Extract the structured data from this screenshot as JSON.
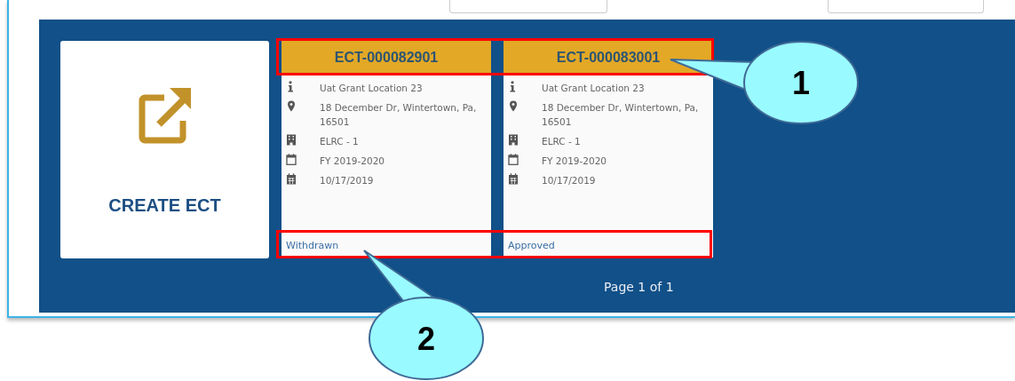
{
  "create_tile": {
    "label": "CREATE ECT"
  },
  "cards": [
    {
      "id": "ECT-000082901",
      "details": [
        {
          "kind": "info",
          "text": "Uat Grant Location 23"
        },
        {
          "kind": "location",
          "text": "18 December Dr, Wintertown, Pa, 16501"
        },
        {
          "kind": "building",
          "text": "ELRC - 1"
        },
        {
          "kind": "calendar",
          "text": "FY 2019-2020"
        },
        {
          "kind": "date",
          "text": "10/17/2019"
        }
      ],
      "status": "Withdrawn"
    },
    {
      "id": "ECT-000083001",
      "details": [
        {
          "kind": "info",
          "text": "Uat Grant Location 23"
        },
        {
          "kind": "location",
          "text": "18 December Dr, Wintertown, Pa, 16501"
        },
        {
          "kind": "building",
          "text": "ELRC - 1"
        },
        {
          "kind": "calendar",
          "text": "FY 2019-2020"
        },
        {
          "kind": "date",
          "text": "10/17/2019"
        }
      ],
      "status": "Approved"
    }
  ],
  "pager": "Page 1 of 1",
  "callouts": [
    {
      "label": "1"
    },
    {
      "label": "2"
    }
  ]
}
